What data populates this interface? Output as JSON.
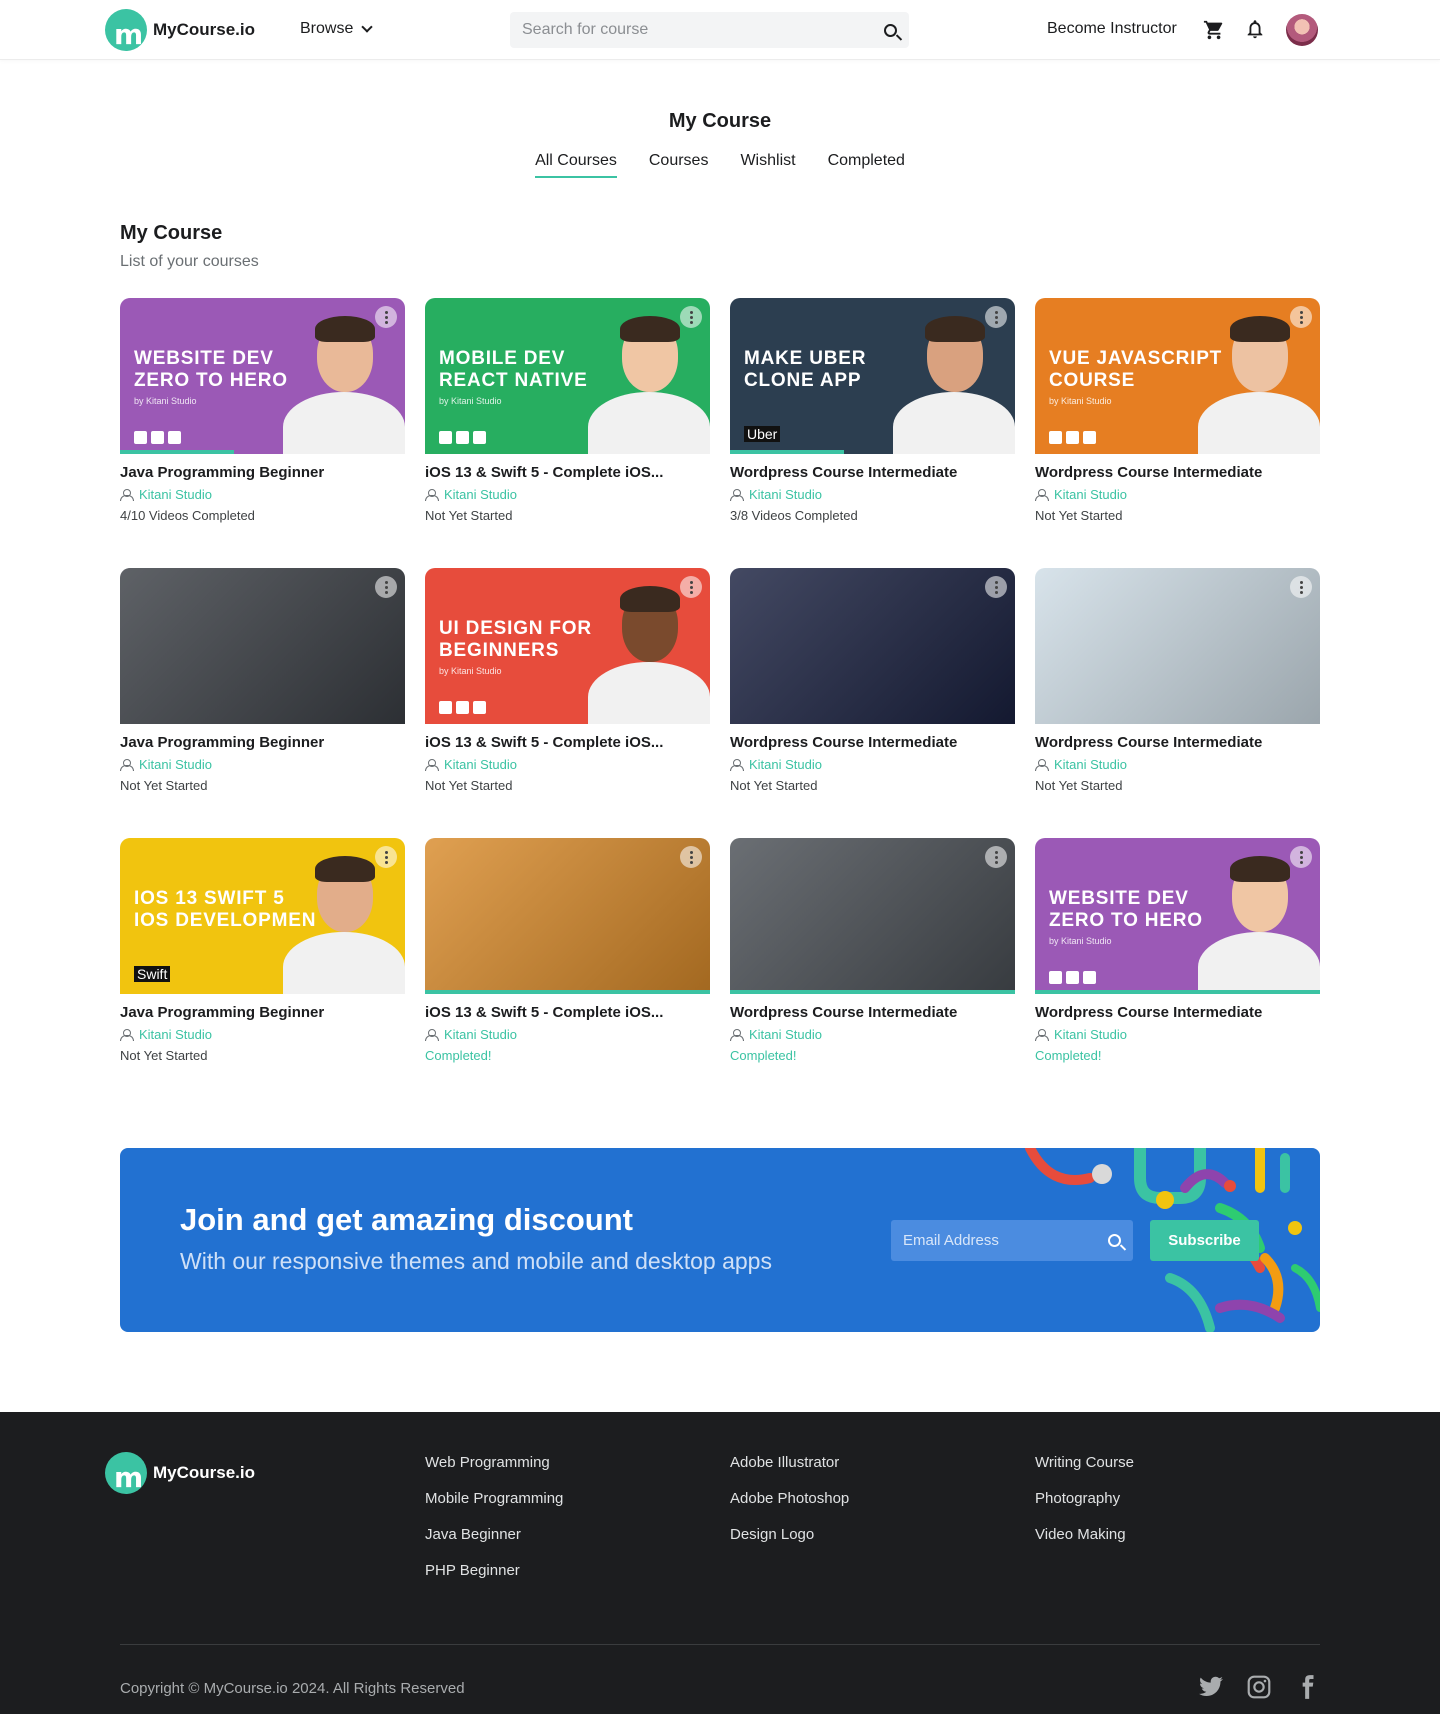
{
  "brand": {
    "name": "MyCourse.io",
    "mark": "m"
  },
  "nav": {
    "browse": "Browse",
    "search_placeholder": "Search for course",
    "become_instructor": "Become Instructor"
  },
  "page": {
    "title": "My Course",
    "tabs": [
      "All Courses",
      "Courses",
      "Wishlist",
      "Completed"
    ],
    "active_tab": "All Courses",
    "section_title": "My Course",
    "section_subtitle": "List of your courses"
  },
  "courses": [
    {
      "title": "Java Programming Beginner",
      "author": "Kitani Studio",
      "status": "4/10 Videos Completed",
      "done": false,
      "progress": 0.4,
      "thumb": {
        "bg": "#9b59b6",
        "headline": "WEBSITE DEV ZERO TO HERO",
        "byline": "by Kitani Studio",
        "tag": ""
      }
    },
    {
      "title": "iOS 13 & Swift 5 - Complete iOS...",
      "author": "Kitani Studio",
      "status": "Not Yet Started",
      "done": false,
      "progress": 0,
      "thumb": {
        "bg": "#27ae60",
        "headline": "MOBILE DEV REACT NATIVE",
        "byline": "by Kitani Studio",
        "tag": ""
      }
    },
    {
      "title": "Wordpress Course Intermediate",
      "author": "Kitani Studio",
      "status": "3/8 Videos Completed",
      "done": false,
      "progress": 0.4,
      "thumb": {
        "bg": "#2c3e50",
        "headline": "MAKE UBER CLONE APP",
        "byline": "",
        "tag": "Uber"
      }
    },
    {
      "title": "Wordpress Course Intermediate",
      "author": "Kitani Studio",
      "status": "Not Yet Started",
      "done": false,
      "progress": 0,
      "thumb": {
        "bg": "#e67e22",
        "headline": "VUE JAVASCRIPT COURSE",
        "byline": "by Kitani Studio",
        "tag": ""
      }
    },
    {
      "title": "Java Programming Beginner",
      "author": "Kitani Studio",
      "status": "Not Yet Started",
      "done": false,
      "progress": 0,
      "thumb": {
        "bg": "#3b3f45",
        "headline": "",
        "byline": "",
        "tag": ""
      }
    },
    {
      "title": "iOS 13 & Swift 5 - Complete iOS...",
      "author": "Kitani Studio",
      "status": "Not Yet Started",
      "done": false,
      "progress": 0,
      "thumb": {
        "bg": "#e74c3c",
        "headline": "UI DESIGN FOR BEGINNERS",
        "byline": "by Kitani Studio",
        "tag": ""
      }
    },
    {
      "title": "Wordpress Course Intermediate",
      "author": "Kitani Studio",
      "status": "Not Yet Started",
      "done": false,
      "progress": 0,
      "thumb": {
        "bg": "#1a2140",
        "headline": "",
        "byline": "",
        "tag": ""
      }
    },
    {
      "title": "Wordpress Course Intermediate",
      "author": "Kitani Studio",
      "status": "Not Yet Started",
      "done": false,
      "progress": 0,
      "thumb": {
        "bg": "#cfdde6",
        "headline": "",
        "byline": "",
        "tag": ""
      }
    },
    {
      "title": "Java Programming Beginner",
      "author": "Kitani Studio",
      "status": "Not Yet Started",
      "done": false,
      "progress": 0,
      "thumb": {
        "bg": "#f1c40f",
        "headline": "IOS 13 SWIFT 5 IOS DEVELOPMEN",
        "byline": "",
        "tag": "Swift"
      }
    },
    {
      "title": "iOS 13 & Swift 5 - Complete iOS...",
      "author": "Kitani Studio",
      "status": "Completed!",
      "done": true,
      "progress": 1,
      "thumb": {
        "bg": "#d98b2b",
        "headline": "",
        "byline": "",
        "tag": ""
      }
    },
    {
      "title": "Wordpress Course Intermediate",
      "author": "Kitani Studio",
      "status": "Completed!",
      "done": true,
      "progress": 1,
      "thumb": {
        "bg": "#4a4f55",
        "headline": "",
        "byline": "",
        "tag": ""
      }
    },
    {
      "title": "Wordpress Course Intermediate",
      "author": "Kitani Studio",
      "status": "Completed!",
      "done": true,
      "progress": 1,
      "thumb": {
        "bg": "#9b59b6",
        "headline": "WEBSITE DEV ZERO TO HERO",
        "byline": "by Kitani Studio",
        "tag": ""
      }
    }
  ],
  "promo": {
    "title": "Join and get amazing discount",
    "subtitle": "With our responsive themes and mobile and desktop apps",
    "email_placeholder": "Email Address",
    "subscribe": "Subscribe"
  },
  "footer": {
    "col1": [
      "Web Programming",
      "Mobile Programming",
      "Java Beginner",
      "PHP Beginner"
    ],
    "col2": [
      "Adobe Illustrator",
      "Adobe Photoshop",
      "Design Logo"
    ],
    "col3": [
      "Writing Course",
      "Photography",
      "Video Making"
    ],
    "copyright": "Copyright © MyCourse.io 2024. All Rights Reserved",
    "social": [
      "twitter-icon",
      "instagram-icon",
      "facebook-icon"
    ]
  },
  "colors": {
    "accent": "#3bc3a3",
    "promo": "#2271d1",
    "footer": "#1c1d1f"
  }
}
